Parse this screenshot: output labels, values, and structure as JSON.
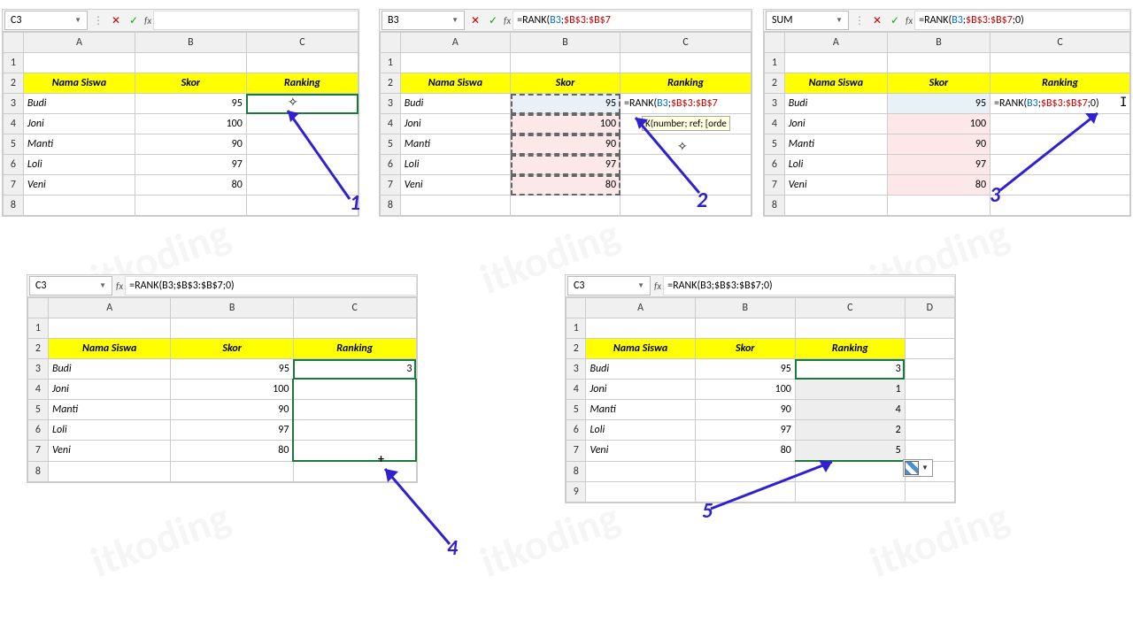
{
  "watermark": "itkoding",
  "headers": {
    "col_a": "Nama Siswa",
    "col_b": "Skor",
    "col_c": "Ranking"
  },
  "rows": [
    {
      "name": "Budi",
      "score": 95,
      "rank": 3
    },
    {
      "name": "Joni",
      "score": 100,
      "rank": 1
    },
    {
      "name": "Manti",
      "score": 90,
      "rank": 4
    },
    {
      "name": "Loli",
      "score": 97,
      "rank": 2
    },
    {
      "name": "Veni",
      "score": 80,
      "rank": 5
    }
  ],
  "panel1": {
    "namebox": "C3",
    "formula": "",
    "cols": {
      "a": "A",
      "b": "B",
      "c": "C"
    }
  },
  "panel2": {
    "namebox": "B3",
    "formula": "=RANK(B3;$B$3:$B$7",
    "cell_formula": "=RANK(B3;$B$3:$B$7",
    "tooltip": "K(number; ref; [orde",
    "cols": {
      "a": "A",
      "b": "B",
      "c": "C"
    }
  },
  "panel3": {
    "namebox": "SUM",
    "formula": "=RANK(B3;$B$3:$B$7;0)",
    "cell_formula": "=RANK(B3;$B$3:$B$7;0)",
    "cols": {
      "a": "A",
      "b": "B",
      "c": "C"
    }
  },
  "panel4": {
    "namebox": "C3",
    "formula": "=RANK(B3;$B$3:$B$7;0)",
    "cols": {
      "a": "A",
      "b": "B",
      "c": "C"
    }
  },
  "panel5": {
    "namebox": "C3",
    "formula": "=RANK(B3;$B$3:$B$7;0)",
    "cols": {
      "a": "A",
      "b": "B",
      "c": "C",
      "d": "D"
    }
  },
  "step_labels": {
    "s1": "1",
    "s2": "2",
    "s3": "3",
    "s4": "4",
    "s5": "5"
  },
  "fx_label": "fx"
}
